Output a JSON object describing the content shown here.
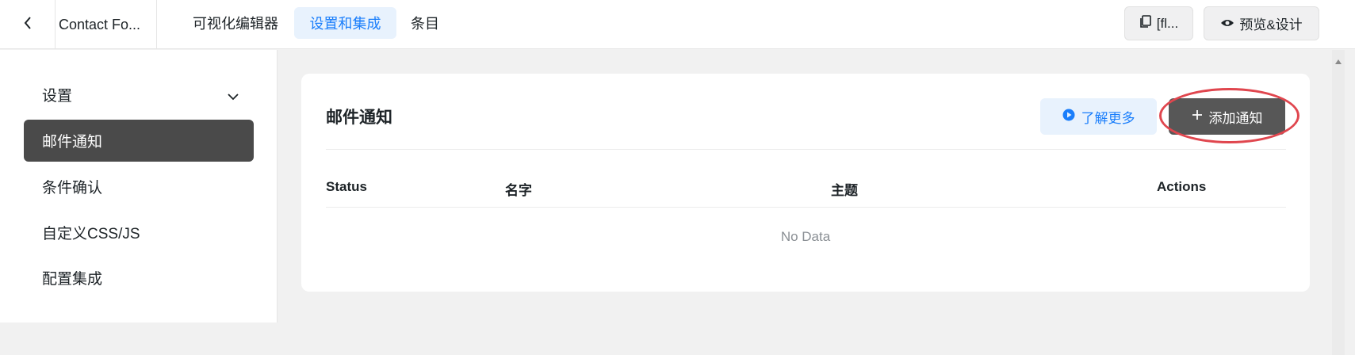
{
  "topbar": {
    "back_icon": "chevron-left-icon",
    "form_title": "Contact Fo...",
    "tabs": [
      {
        "label": "可视化编辑器",
        "active": false
      },
      {
        "label": "设置和集成",
        "active": true
      },
      {
        "label": "条目",
        "active": false
      }
    ],
    "shortcode_button": {
      "icon": "copy-icon",
      "label": "[fl..."
    },
    "preview_button": {
      "icon": "eye-icon",
      "label": "预览&设计"
    }
  },
  "sidebar": {
    "items": [
      {
        "label": "设置",
        "icon": "chevron-down-icon",
        "active": false
      },
      {
        "label": "邮件通知",
        "active": true
      },
      {
        "label": "条件确认",
        "active": false
      },
      {
        "label": "自定义CSS/JS",
        "active": false
      },
      {
        "label": "配置集成",
        "active": false
      }
    ]
  },
  "main": {
    "title": "邮件通知",
    "learn_more": {
      "icon": "play-circle-icon",
      "label": "了解更多"
    },
    "add_button": {
      "icon": "plus-icon",
      "label": "添加通知"
    },
    "table": {
      "columns": [
        "Status",
        "名字",
        "主题",
        "Actions"
      ],
      "empty_text": "No Data"
    }
  },
  "colors": {
    "accent": "#1a7efb",
    "accent_bg": "#e8f2fd",
    "active_sidebar": "#4a4a4a",
    "add_button": "#575757",
    "highlight": "#e0464e"
  }
}
